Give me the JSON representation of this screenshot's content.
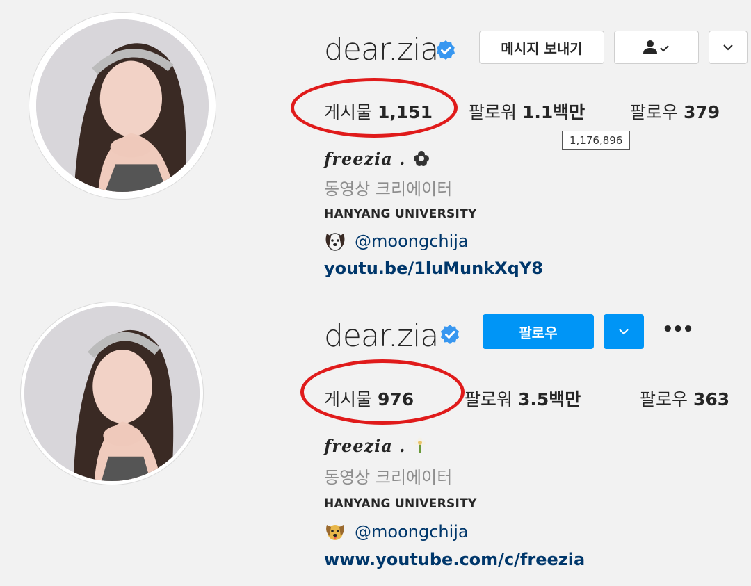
{
  "profiles": [
    {
      "username": "dear.zia",
      "buttons": {
        "message": "메시지 보내기"
      },
      "stats": {
        "posts_label": "게시물",
        "posts_value": "1,151",
        "followers_label": "팔로워",
        "followers_value": "1.1백만",
        "following_label": "팔로우",
        "following_value": "379"
      },
      "tooltip": "1,176,896",
      "fullname": "freezia .",
      "category": "동영상 크리에이터",
      "bio": "HANYANG UNIVERSITY",
      "mention": "@moongchija",
      "link": "youtu.be/1luMunkXqY8",
      "emoji_icon": "dog-face-icon"
    },
    {
      "username": "dear.zia",
      "buttons": {
        "follow": "팔로우",
        "more": "•••"
      },
      "stats": {
        "posts_label": "게시물",
        "posts_value": "976",
        "followers_label": "팔로워",
        "followers_value": "3.5백만",
        "following_label": "팔로우",
        "following_value": "363"
      },
      "fullname": "freezia .",
      "category": "동영상 크리에이터",
      "bio": "HANYANG UNIVERSITY",
      "mention": "@moongchija",
      "link": "www.youtube.com/c/freezia",
      "emoji_icon": "dog-face-icon"
    }
  ],
  "colors": {
    "accent_blue": "#0095f6",
    "verified_blue": "#3897f0",
    "highlight_red": "#e01b1b",
    "link_blue": "#00376b"
  }
}
